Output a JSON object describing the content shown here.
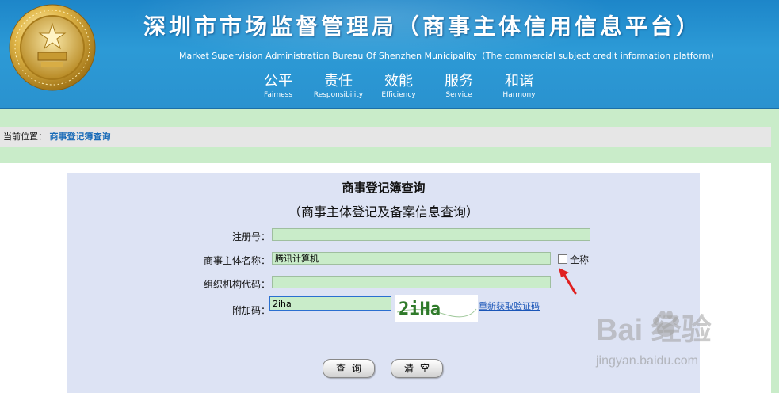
{
  "header": {
    "title": "深圳市市场监督管理局（商事主体信用信息平台）",
    "subtitle": "Market  Supervision  Administration Bureau Of Shenzhen Municipality（The commercial subject credit information platform）",
    "slogans": [
      {
        "cn": "公平",
        "en": "Faimess"
      },
      {
        "cn": "责任",
        "en": "Responsibility"
      },
      {
        "cn": "效能",
        "en": "Efficiency"
      },
      {
        "cn": "服务",
        "en": "Service"
      },
      {
        "cn": "和谐",
        "en": "Harmony"
      }
    ]
  },
  "breadcrumb": {
    "prefix": "当前位置：",
    "current": "商事登记簿查询"
  },
  "form": {
    "title": "商事登记簿查询",
    "subtitle": "（商事主体登记及备案信息查询）",
    "fields": {
      "reg_no": {
        "label": "注册号：",
        "value": ""
      },
      "entity_name": {
        "label": "商事主体名称：",
        "value": "腾讯计算机"
      },
      "org_code": {
        "label": "组织机构代码：",
        "value": ""
      },
      "captcha": {
        "label": "附加码：",
        "value": "2iha"
      }
    },
    "full_name_checkbox": {
      "label": "全称",
      "checked": false
    },
    "captcha_image_text": "2iHa",
    "refresh_captcha": "重新获取验证码",
    "query_button": "查询",
    "clear_button": "清空"
  },
  "watermark": {
    "logo": "Bai  经验",
    "url": "jingyan.baidu.com"
  },
  "colors": {
    "banner_blue": "#2a92cf",
    "page_green": "#c9ecc9",
    "panel_lavender": "#dde3f4",
    "link_blue": "#1a6cb8",
    "arrow_red": "#e02020",
    "captcha_green": "#2f7a2a"
  },
  "icons": [
    "emblem-icon",
    "red-arrow-icon",
    "baidu-paw-icon"
  ]
}
